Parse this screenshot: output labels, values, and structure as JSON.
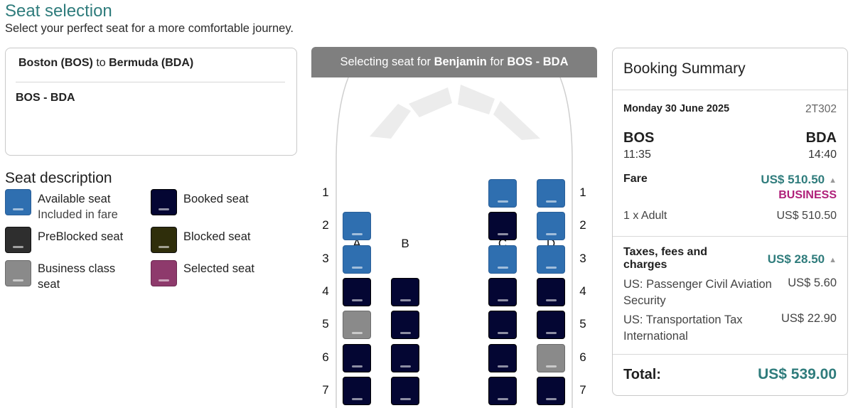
{
  "page": {
    "title": "Seat selection",
    "subtitle": "Select your perfect seat for a more comfortable journey."
  },
  "route": {
    "origin": "Boston (BOS)",
    "connector": "to",
    "destination": "Bermuda (BDA)",
    "leg": "BOS - BDA"
  },
  "legend": {
    "title": "Seat description",
    "items": [
      {
        "label": "Available seat",
        "sub": "Included in fare",
        "color": "#2f6fb0"
      },
      {
        "label": "Booked seat",
        "sub": "",
        "color": "#040633"
      },
      {
        "label": "PreBlocked seat",
        "sub": "",
        "color": "#2e2e2e"
      },
      {
        "label": "Blocked seat",
        "sub": "",
        "color": "#2f2e0b"
      },
      {
        "label": "Business class seat",
        "sub": "",
        "color": "#8a8a8a"
      },
      {
        "label": "Selected seat",
        "sub": "",
        "color": "#8e3a6c"
      }
    ]
  },
  "seatmap": {
    "header_prefix": "Selecting seat for",
    "passenger": "Benjamin",
    "header_mid": "for",
    "flight_leg": "BOS - BDA",
    "columns": [
      "A",
      "B",
      "C",
      "D"
    ],
    "rows": [
      {
        "num": "1",
        "seats": {
          "A": "none",
          "B": "none",
          "C": "available",
          "D": "available"
        }
      },
      {
        "num": "2",
        "seats": {
          "A": "available",
          "B": "none",
          "C": "booked",
          "D": "available"
        }
      },
      {
        "num": "3",
        "seats": {
          "A": "available",
          "B": "none",
          "C": "available",
          "D": "available"
        }
      },
      {
        "num": "4",
        "seats": {
          "A": "booked",
          "B": "booked",
          "C": "booked",
          "D": "booked"
        }
      },
      {
        "num": "5",
        "seats": {
          "A": "business",
          "B": "booked",
          "C": "booked",
          "D": "booked"
        }
      },
      {
        "num": "6",
        "seats": {
          "A": "booked",
          "B": "booked",
          "C": "booked",
          "D": "business"
        }
      },
      {
        "num": "7",
        "seats": {
          "A": "booked",
          "B": "booked",
          "C": "booked",
          "D": "booked"
        }
      }
    ]
  },
  "summary": {
    "title": "Booking Summary",
    "date": "Monday 30 June 2025",
    "flight_no": "2T302",
    "origin_code": "BOS",
    "dest_code": "BDA",
    "depart_time": "11:35",
    "arrive_time": "14:40",
    "fare_label": "Fare",
    "fare_amount": "US$ 510.50",
    "fare_class": "BUSINESS",
    "pax_label": "1 x Adult",
    "pax_amount": "US$ 510.50",
    "taxes_label_1": "Taxes, fees and",
    "taxes_label_2": "charges",
    "taxes_amount": "US$ 28.50",
    "tax1_label_1": "US: Passenger Civil Aviation",
    "tax1_label_2": "Security",
    "tax1_amount": "US$ 5.60",
    "tax2_label_1": "US: Transportation Tax",
    "tax2_label_2": "International",
    "tax2_amount": "US$ 22.90",
    "total_label": "Total:",
    "total_amount": "US$ 539.00",
    "colors": {
      "teal": "#2f7c7c",
      "business": "#b0217a"
    }
  }
}
